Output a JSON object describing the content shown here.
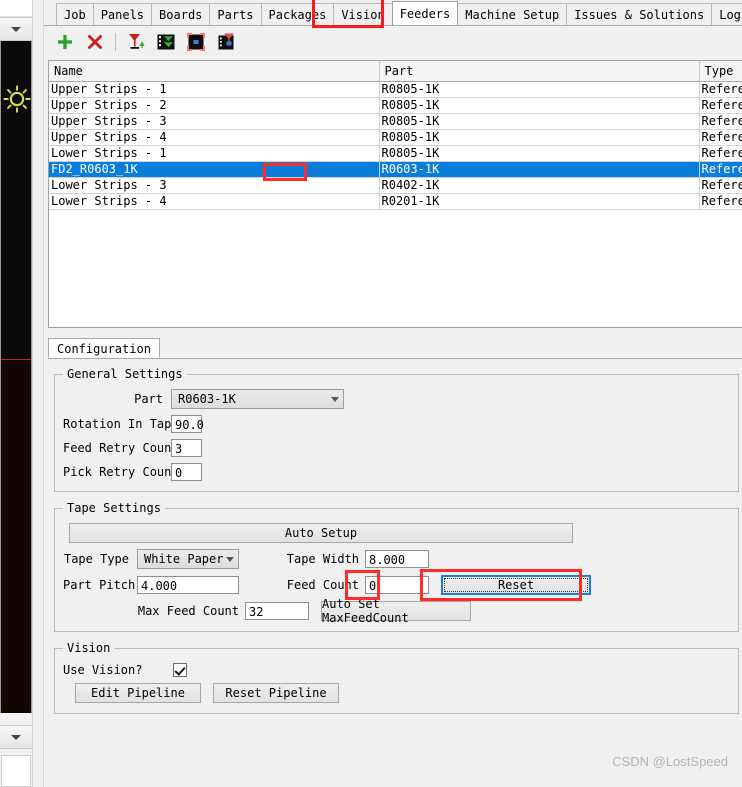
{
  "window": {
    "watermark": "CSDN @LostSpeed"
  },
  "sidebar": {
    "top_collapse_icon": "chevron-down-icon",
    "bottom_collapse_icon": "chevron-down-icon",
    "camera_icon": "sun-brightness-icon"
  },
  "tabs": {
    "items": [
      {
        "label": "Job",
        "active": false
      },
      {
        "label": "Panels",
        "active": false
      },
      {
        "label": "Boards",
        "active": false
      },
      {
        "label": "Parts",
        "active": false
      },
      {
        "label": "Packages",
        "active": false
      },
      {
        "label": "Vision",
        "active": false
      },
      {
        "label": "Feeders",
        "active": true
      },
      {
        "label": "Machine Setup",
        "active": false
      },
      {
        "label": "Issues & Solutions",
        "active": false
      },
      {
        "label": "Log",
        "active": false
      }
    ]
  },
  "toolbar": {
    "buttons": [
      {
        "name": "add-feeder-button",
        "icon": "plus-icon",
        "label": "+"
      },
      {
        "name": "delete-feeder-button",
        "icon": "cross-icon",
        "label": "×"
      },
      {
        "name": "pick-feeder-button",
        "icon": "pick-nozzle-icon",
        "label": ""
      },
      {
        "name": "feed-button",
        "icon": "feed-tape-icon",
        "label": ""
      },
      {
        "name": "show-part-button",
        "icon": "locate-part-icon",
        "label": ""
      },
      {
        "name": "pick-part-button",
        "icon": "pick-part-icon",
        "label": ""
      }
    ]
  },
  "table": {
    "columns": [
      "Name",
      "Part",
      "Type"
    ],
    "rows": [
      {
        "name": "Upper Strips - 1",
        "part": "R0805-1K",
        "type": "Referenc",
        "selected": false
      },
      {
        "name": "Upper Strips - 2",
        "part": "R0805-1K",
        "type": "Referenc",
        "selected": false
      },
      {
        "name": "Upper Strips - 3",
        "part": "R0805-1K",
        "type": "Referenc",
        "selected": false
      },
      {
        "name": "Upper Strips - 4",
        "part": "R0805-1K",
        "type": "Referenc",
        "selected": false
      },
      {
        "name": "Lower Strips - 1",
        "part": "R0805-1K",
        "type": "Referenc",
        "selected": false
      },
      {
        "name": "FD2_R0603_1K",
        "part": "R0603-1K",
        "type": "Referenc",
        "selected": true
      },
      {
        "name": "Lower Strips - 3",
        "part": "R0402-1K",
        "type": "Referenc",
        "selected": false
      },
      {
        "name": "Lower Strips - 4",
        "part": "R0201-1K",
        "type": "Referenc",
        "selected": false
      }
    ]
  },
  "config": {
    "tab_label": "Configuration",
    "general": {
      "legend": "General Settings",
      "part_label": "Part",
      "part_value": "R0603-1K",
      "rotation_label": "Rotation In Tape",
      "rotation_value": "90.0",
      "feed_retry_label": "Feed Retry Count",
      "feed_retry_value": "3",
      "pick_retry_label": "Pick Retry Count",
      "pick_retry_value": "0"
    },
    "tape": {
      "legend": "Tape Settings",
      "auto_setup_label": "Auto Setup",
      "tape_type_label": "Tape Type",
      "tape_type_value": "White Paper",
      "tape_width_label": "Tape Width",
      "tape_width_value": "8.000",
      "part_pitch_label": "Part Pitch",
      "part_pitch_value": "4.000",
      "feed_count_label": "Feed Count",
      "feed_count_value": "0",
      "reset_label": "Reset",
      "max_feed_count_label": "Max Feed Count",
      "max_feed_count_value": "32",
      "auto_set_max_label": "Auto Set MaxFeedCount"
    },
    "vision": {
      "legend": "Vision",
      "use_vision_label": "Use Vision?",
      "use_vision_checked": true,
      "edit_pipeline_label": "Edit Pipeline",
      "reset_pipeline_label": "Reset Pipeline"
    }
  },
  "annotations": {
    "highlight_color": "#ff2b2b",
    "boxes": [
      {
        "name": "feeders-tab-highlight"
      },
      {
        "name": "selected-row-highlight"
      },
      {
        "name": "feed-count-highlight"
      },
      {
        "name": "reset-button-highlight"
      }
    ]
  }
}
